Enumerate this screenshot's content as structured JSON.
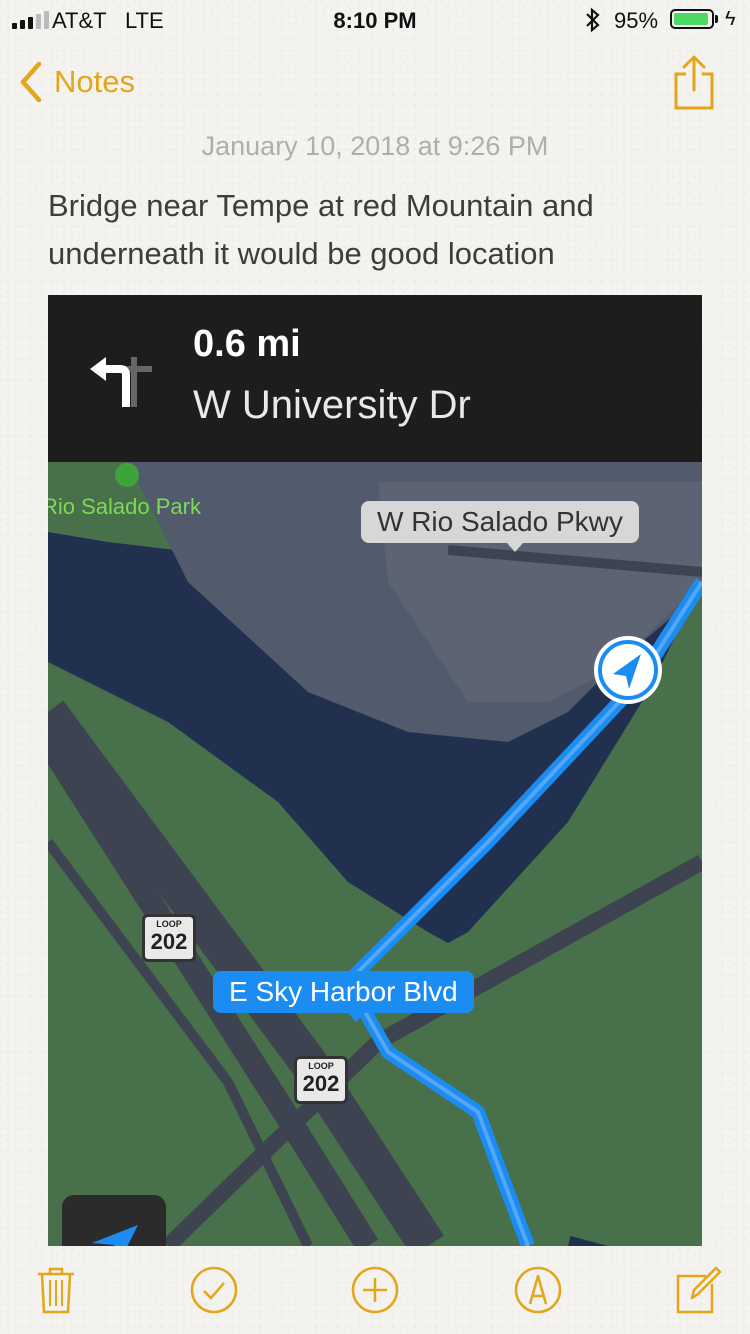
{
  "status_bar": {
    "carrier": "AT&T",
    "network": "LTE",
    "time": "8:10 PM",
    "battery_percent": "95%",
    "battery_level": 0.95,
    "battery_color": "#4cd964",
    "icons": [
      "signal-bars-icon",
      "bluetooth-icon",
      "battery-icon",
      "charging-bolt-icon"
    ]
  },
  "nav": {
    "back_label": "Notes",
    "accent_color": "#e4a51a",
    "icons": [
      "chevron-left-icon",
      "share-icon"
    ]
  },
  "note": {
    "date": "January 10, 2018 at 9:26 PM",
    "body": "Bridge near Tempe at red Mountain and underneath it would be good location"
  },
  "attachment": {
    "navigation": {
      "distance": "0.6 mi",
      "street": "W University Dr",
      "icon": "turn-left-icon"
    },
    "map": {
      "park_label": "Rio Salado Park",
      "street_label_top": "W Rio Salado Pkwy",
      "street_label_current": "E Sky Harbor Blvd",
      "shield_top_text": "LOOP",
      "shield_number": "202",
      "route_color": "#1a8cf2"
    }
  },
  "toolbar": {
    "icons": [
      "trash-icon",
      "checklist-icon",
      "add-icon",
      "markup-icon",
      "compose-icon"
    ]
  }
}
